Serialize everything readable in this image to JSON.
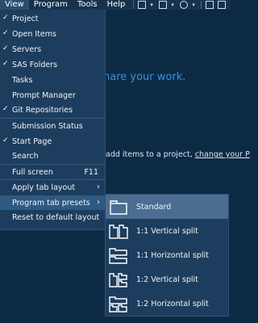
{
  "menubar": {
    "items": [
      "View",
      "Program",
      "Tools",
      "Help"
    ],
    "toolbar_icons": [
      "new-file-icon",
      "open-file-icon",
      "settings-gear-icon",
      "save-icon",
      "save-all-icon"
    ]
  },
  "background": {
    "headline": "hare your work.",
    "hint_prefix": "add items to a project, ",
    "hint_link": "change your P"
  },
  "view_menu": {
    "items": [
      {
        "label": "Project",
        "checked": true
      },
      {
        "label": "Open Items",
        "checked": true
      },
      {
        "label": "Servers",
        "checked": true
      },
      {
        "label": "SAS Folders",
        "checked": true
      },
      {
        "label": "Tasks",
        "checked": false
      },
      {
        "label": "Prompt Manager",
        "checked": false
      },
      {
        "label": "Git Repositories",
        "checked": true
      },
      {
        "label": "Submission Status",
        "checked": false
      },
      {
        "label": "Start Page",
        "checked": true
      },
      {
        "label": "Search",
        "checked": false
      },
      {
        "label": "Full screen",
        "shortcut": "F11"
      },
      {
        "label": "Apply tab layout",
        "arrow": "›"
      },
      {
        "label": "Program tab presets",
        "arrow": "›"
      },
      {
        "label": "Reset to default layout"
      }
    ],
    "check_glyph": "✓"
  },
  "presets_submenu": {
    "items": [
      {
        "label": "Standard",
        "icon": "standard-layout-icon"
      },
      {
        "label": "1:1 Vertical split",
        "icon": "vertical-split-1-1-icon"
      },
      {
        "label": "1:1 Horizontal split",
        "icon": "horizontal-split-1-1-icon"
      },
      {
        "label": "1:2 Vertical split",
        "icon": "vertical-split-1-2-icon"
      },
      {
        "label": "1:2 Horizontal split",
        "icon": "horizontal-split-1-2-icon"
      }
    ],
    "highlighted": "Standard"
  },
  "colors": {
    "background": "#0d2a45",
    "menu": "#1d3d5e",
    "highlight": "#2e5a82",
    "accent_text": "#3d8fe0"
  }
}
